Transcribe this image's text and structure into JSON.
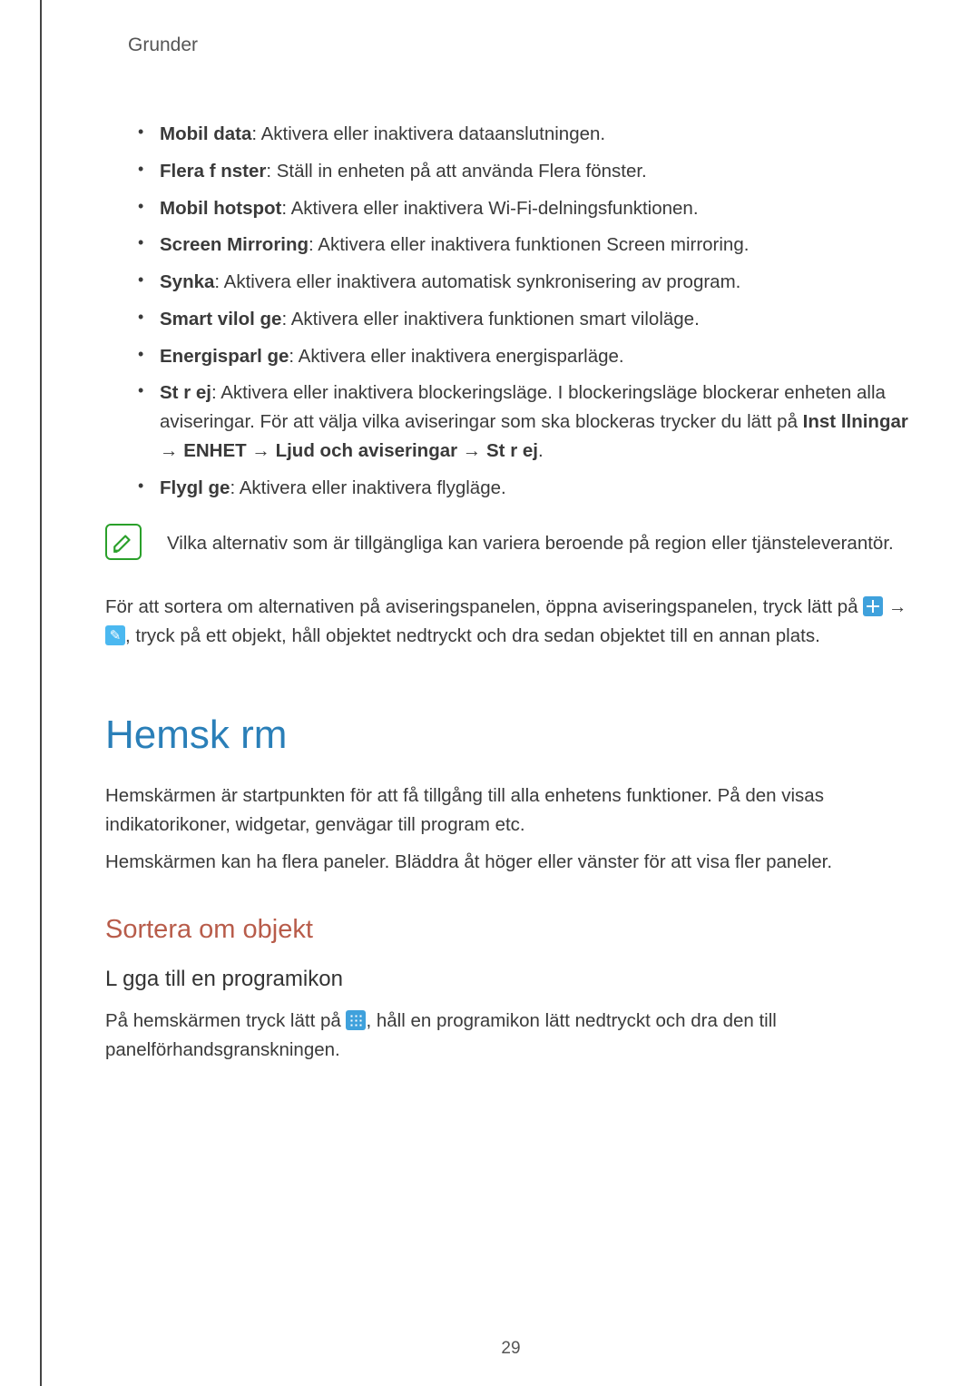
{
  "header": {
    "tab": "Grunder"
  },
  "definitions": [
    {
      "term": "Mobil data",
      "desc": ": Aktivera eller inaktivera dataanslutningen."
    },
    {
      "term": "Flera f nster",
      "desc": ": Ställ in enheten på att använda Flera fönster."
    },
    {
      "term": "Mobil hotspot",
      "desc": ": Aktivera eller inaktivera Wi-Fi-delningsfunktionen."
    },
    {
      "term": "Screen Mirroring",
      "desc": ": Aktivera eller inaktivera funktionen Screen mirroring."
    },
    {
      "term": "Synka",
      "desc": ": Aktivera eller inaktivera automatisk synkronisering av program."
    },
    {
      "term": "Smart vilol ge",
      "desc": ": Aktivera eller inaktivera funktionen smart viloläge."
    },
    {
      "term": "Energisparl ge",
      "desc": ": Aktivera eller inaktivera energisparläge."
    },
    {
      "term": "St r ej",
      "desc": ": Aktivera eller inaktivera blockeringsläge. I blockeringsläge blockerar enheten alla aviseringar. För att välja vilka aviseringar som ska blockeras trycker du lätt på ",
      "trail": [
        "Inst llningar",
        " → ",
        "ENHET",
        " → ",
        "Ljud och aviseringar",
        " → ",
        "St r ej",
        "."
      ]
    },
    {
      "term": "Flygl ge",
      "desc": ": Aktivera eller inaktivera flygläge."
    }
  ],
  "note": "Vilka alternativ som är tillgängliga kan variera beroende på region eller tjänsteleverantör.",
  "sort_intro_pre": "För att sortera om alternativen på aviseringspanelen, öppna aviseringspanelen, tryck lätt på ",
  "arrow1": " → ",
  "sort_intro_post": ", tryck på ett objekt, håll objektet nedtryckt och dra sedan objektet till en annan plats.",
  "h1": "Hemsk rm",
  "p1": "Hemskärmen är startpunkten för att få tillgång till alla enhetens funktioner. På den visas indikatorikoner, widgetar, genvägar till program etc.",
  "p2": "Hemskärmen kan ha flera paneler. Bläddra åt höger eller vänster för att visa fler paneler.",
  "h2": "Sortera om objekt",
  "h3": "L gga till en programikon",
  "p3_pre": "På hemskärmen tryck lätt på ",
  "p3_post": ", håll en programikon lätt nedtryckt och dra den till panelförhandsgranskningen.",
  "page_number": "29"
}
